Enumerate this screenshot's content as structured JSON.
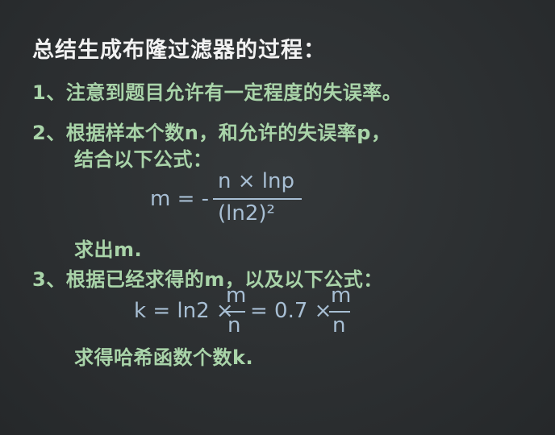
{
  "title": "总结生成布隆过滤器的过程：",
  "step1": "1、注意到题目允许有一定程度的失误率。",
  "step2_line1": "2、根据样本个数n，和允许的失误率p，",
  "step2_line2": "结合以下公式：",
  "formula1": {
    "lhs": "m = -",
    "numerator": "n × lnp",
    "denominator": "(ln2)²"
  },
  "step2_result": "求出m.",
  "step3_line1": "3、根据已经求得的m，以及以下公式：",
  "formula2": {
    "prefix": "k = ln2 ×",
    "frac1_num": "m",
    "frac1_den": "n",
    "middle": "= 0.7 ×",
    "frac2_num": "m",
    "frac2_den": "n"
  },
  "step3_result": "求得哈希函数个数k.",
  "colors": {
    "background": "#2b2e30",
    "title": "#f2f2f2",
    "step_text": "#a9d4a9",
    "formula": "#a8bfd4"
  }
}
